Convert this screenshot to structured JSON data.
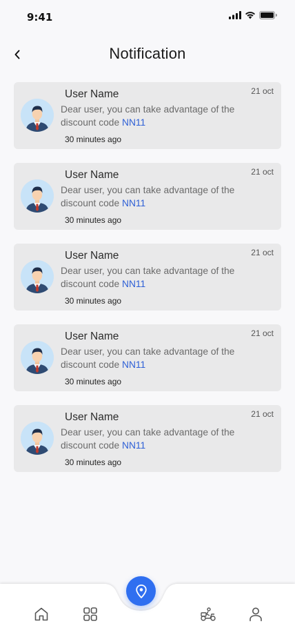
{
  "status_bar": {
    "time": "9:41"
  },
  "header": {
    "title": "Notification"
  },
  "notifications": [
    {
      "user": "User Name",
      "date": "21 oct",
      "message": "Dear user, you can take advantage of the discount code ",
      "code": "NN11",
      "time": "30 minutes ago"
    },
    {
      "user": "User Name",
      "date": "21 oct",
      "message": "Dear user, you can take advantage of the discount code ",
      "code": "NN11",
      "time": "30 minutes ago"
    },
    {
      "user": "User Name",
      "date": "21 oct",
      "message": "Dear user, you can take advantage of the discount code ",
      "code": "NN11",
      "time": "30 minutes ago"
    },
    {
      "user": "User Name",
      "date": "21 oct",
      "message": "Dear user, you can take advantage of the discount code ",
      "code": "NN11",
      "time": "30 minutes ago"
    },
    {
      "user": "User Name",
      "date": "21 oct",
      "message": "Dear user, you can take advantage of the discount code ",
      "code": "NN11",
      "time": "30 minutes ago"
    }
  ],
  "bottom_nav": {
    "items": [
      "home-icon",
      "grid-icon",
      "location-pin-icon",
      "delivery-scooter-icon",
      "profile-icon"
    ],
    "accent": "#2f6ff0"
  }
}
